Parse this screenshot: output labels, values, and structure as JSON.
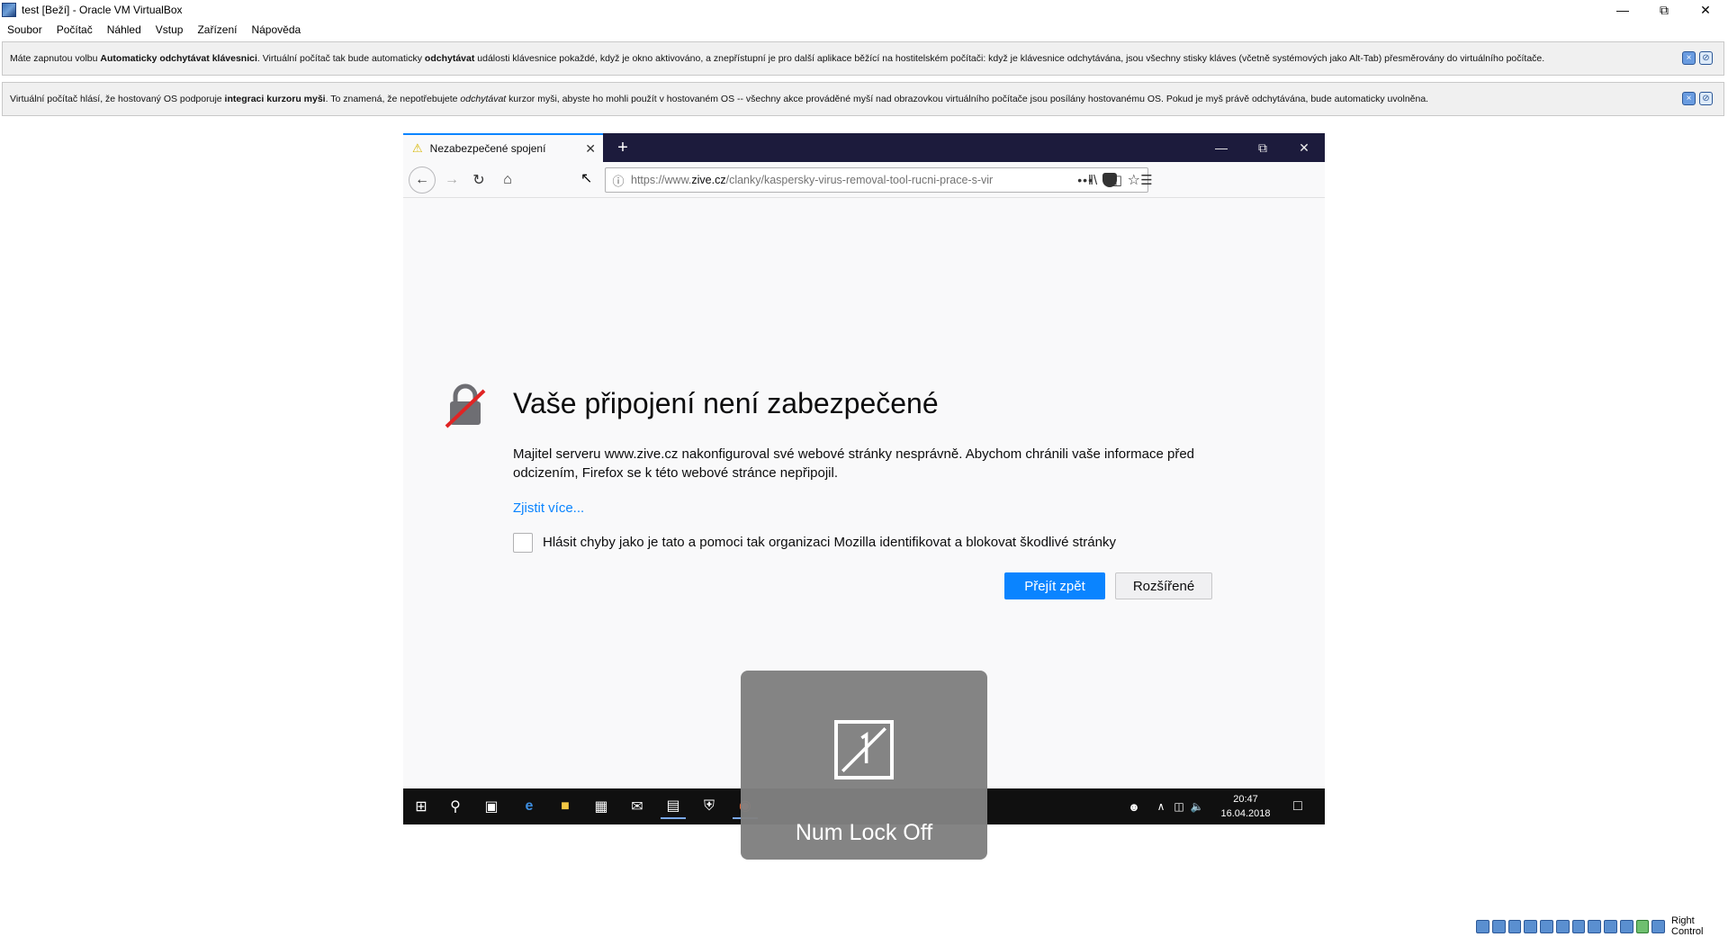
{
  "host": {
    "title": "test [Beží] - Oracle VM VirtualBox",
    "menu": [
      "Soubor",
      "Počítač",
      "Náhled",
      "Vstup",
      "Zařízení",
      "Nápověda"
    ],
    "notice_keyboard": {
      "p1": "Máte zapnutou volbu ",
      "b1": "Automaticky odchytávat klávesnici",
      "p2": ". Virtuální počítač tak bude automaticky ",
      "b2": "odchytávat",
      "p3": " události klávesnice pokaždé, když je okno aktivováno, a znepřístupní je pro další aplikace běžící na hostitelském počítači: když je klávesnice odchytávána, jsou všechny stisky kláves (včetně systémových jako Alt-Tab) přesměrovány do virtuálního počítače."
    },
    "notice_mouse": {
      "p1": "Virtuální počítač hlásí, že hostovaný OS podporuje ",
      "b1": "integraci kurzoru myši",
      "p2": ". To znamená, že nepotřebujete ",
      "i1": "odchytávat",
      "p3": " kurzor myši, abyste ho mohli použít v hostovaném OS -- všechny akce prováděné myší nad obrazovkou virtuálního počítače jsou posílány hostovanému OS. Pokud je myš právě odchytávána, bude automaticky uvolněna."
    },
    "host_key": "Right Control"
  },
  "browser": {
    "tab_title": "Nezabezpečené spojení",
    "url_prefix": "https://www.",
    "url_domain": "zive.cz",
    "url_path": "/clanky/kaspersky-virus-removal-tool-rucni-prace-s-vir",
    "url_more": "•••"
  },
  "error_page": {
    "title": "Vaše připojení není zabezpečené",
    "description": "Majitel serveru www.zive.cz nakonfiguroval své webové stránky nesprávně. Abychom chránili vaše informace před odcizením, Firefox se k této webové stránce nepřipojil.",
    "learn_more": "Zjistit více...",
    "checkbox_label": "Hlásit chyby jako je tato a pomoci tak organizaci Mozilla identifikovat a blokovat škodlivé stránky",
    "go_back": "Přejít zpět",
    "advanced": "Rozšířené"
  },
  "taskbar": {
    "time": "20:47",
    "date": "16.04.2018"
  },
  "osd": {
    "label": "Num Lock Off"
  },
  "colors": {
    "accent": "#0a84ff",
    "tabbar": "#1c1b3c",
    "taskbar": "#101010"
  }
}
